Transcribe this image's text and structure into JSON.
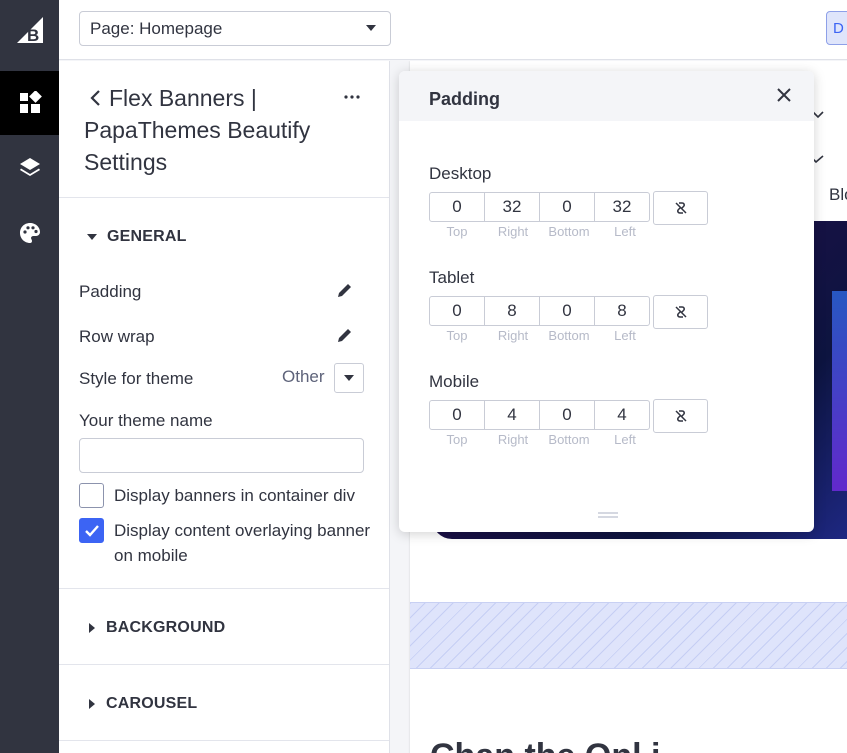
{
  "topbar": {
    "page_select": "Page: Homepage",
    "right_button": "D"
  },
  "sidebar": {
    "title": "Flex Banners | PapaThemes Beautify Settings",
    "title_line1": "Flex Banners |",
    "title_line2": "PapaThemes Beautify",
    "title_line3": "Settings",
    "sections": {
      "general": "GENERAL",
      "background": "BACKGROUND",
      "carousel": "CAROUSEL"
    },
    "fields": {
      "padding": "Padding",
      "row_wrap": "Row wrap",
      "style_for_theme": "Style for theme",
      "style_value": "Other",
      "theme_name_label": "Your theme name",
      "theme_name_value": "",
      "container_div_label": "Display banners in container div",
      "container_div_checked": false,
      "overlay_label": "Display content overlaying banner on mobile",
      "overlay_checked": true
    }
  },
  "preview": {
    "blog": "Blog",
    "heading_fragment": "Chan the Onl   i"
  },
  "padding_popover": {
    "title": "Padding",
    "side_labels": [
      "Top",
      "Right",
      "Bottom",
      "Left"
    ],
    "devices": [
      {
        "label": "Desktop",
        "values": [
          "0",
          "32",
          "0",
          "32"
        ]
      },
      {
        "label": "Tablet",
        "values": [
          "0",
          "8",
          "0",
          "8"
        ]
      },
      {
        "label": "Mobile",
        "values": [
          "0",
          "4",
          "0",
          "4"
        ]
      }
    ]
  },
  "colors": {
    "rail": "#313440",
    "accent": "#3c64f4",
    "text": "#313440"
  }
}
